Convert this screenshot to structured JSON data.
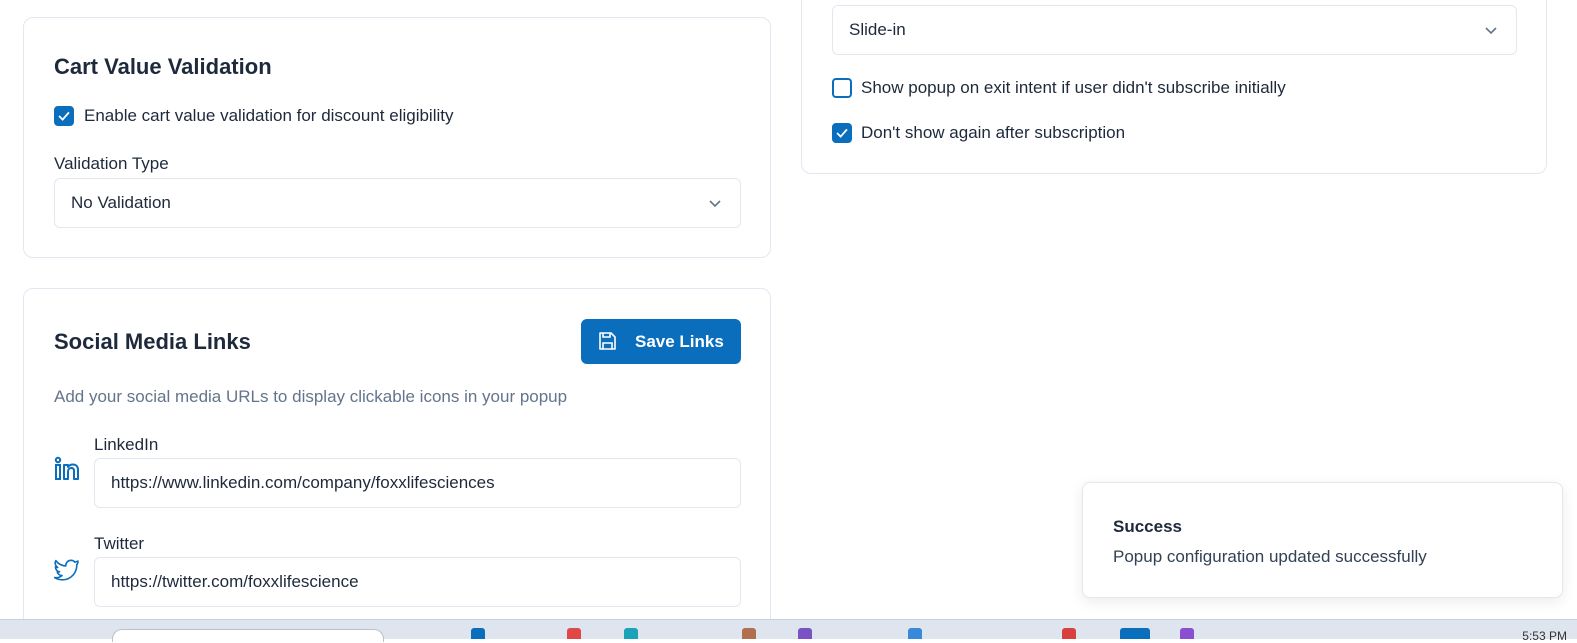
{
  "cart": {
    "title": "Cart Value Validation",
    "enable_label": "Enable cart value validation for discount eligibility",
    "enable_checked": true,
    "validation_type_label": "Validation Type",
    "validation_type_value": "No Validation"
  },
  "popup": {
    "animation_value": "Slide-in",
    "exit_intent_label": "Show popup on exit intent if user didn't subscribe initially",
    "exit_intent_checked": false,
    "dont_show_label": "Don't show again after subscription",
    "dont_show_checked": true
  },
  "social": {
    "title": "Social Media Links",
    "save_label": "Save Links",
    "description": "Add your social media URLs to display clickable icons in your popup",
    "linkedin_label": "LinkedIn",
    "linkedin_value": "https://www.linkedin.com/company/foxxlifesciences",
    "twitter_label": "Twitter",
    "twitter_value": "https://twitter.com/foxxlifescience"
  },
  "toast": {
    "title": "Success",
    "message": "Popup configuration updated successfully"
  },
  "taskbar": {
    "clock": "5:53 PM"
  },
  "colors": {
    "primary": "#0a6ebd",
    "border": "#e2e8f0",
    "muted_text": "#64748b"
  }
}
